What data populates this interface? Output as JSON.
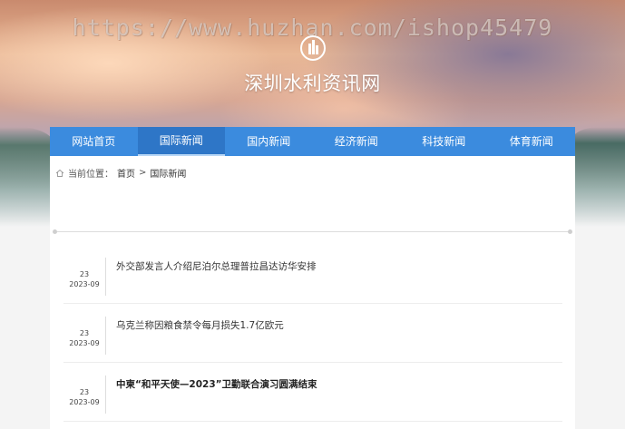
{
  "header": {
    "watermark": "https://www.huzhan.com/ishop45479",
    "site_title": "深圳水利资讯网"
  },
  "nav": {
    "items": [
      "网站首页",
      "国际新闻",
      "国内新闻",
      "经济新闻",
      "科技新闻",
      "体育新闻"
    ],
    "active": "国际新闻"
  },
  "breadcrumb": {
    "label": "当前位置：",
    "home": "首页",
    "sep": ">",
    "current": "国际新闻"
  },
  "news": [
    {
      "day": "23",
      "month": "2023-09",
      "title": "外交部发言人介绍尼泊尔总理普拉昌达访华安排"
    },
    {
      "day": "23",
      "month": "2023-09",
      "title": "乌克兰称因粮食禁令每月损失1.7亿欧元"
    },
    {
      "day": "23",
      "month": "2023-09",
      "title": "中柬“和平天使—2023”卫勤联合演习圆满结束"
    }
  ],
  "colors": {
    "nav": "#3b8bde",
    "nav_active": "#2e76c7"
  }
}
